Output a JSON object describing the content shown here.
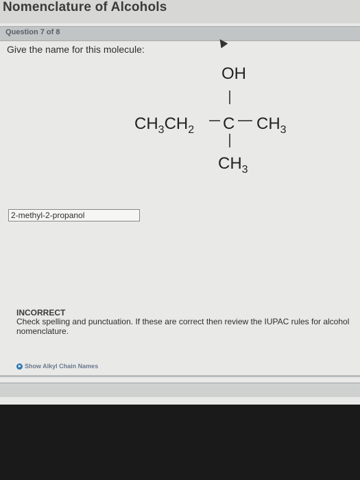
{
  "page": {
    "title": "Nomenclature of Alcohols"
  },
  "question": {
    "number_label": "Question 7 of 8",
    "prompt": "Give the name for this molecule:"
  },
  "molecule": {
    "oh": "OH",
    "left_chain": "CH3CH2",
    "center": "C",
    "right_group": "CH3",
    "bottom_group": "CH3"
  },
  "answer": {
    "value": "2-methyl-2-propanol"
  },
  "feedback": {
    "status": "INCORRECT",
    "message": "Check spelling and punctuation. If these are correct then review the IUPAC rules for alcohol nomenclature."
  },
  "links": {
    "show_alkyl": "Show Alkyl Chain Names"
  },
  "icons": {
    "cursor": "mouse-pointer-icon",
    "show_link": "play-circle-icon"
  },
  "colors": {
    "link_icon": "#2e79b5",
    "link_text": "#6a7a8e"
  }
}
